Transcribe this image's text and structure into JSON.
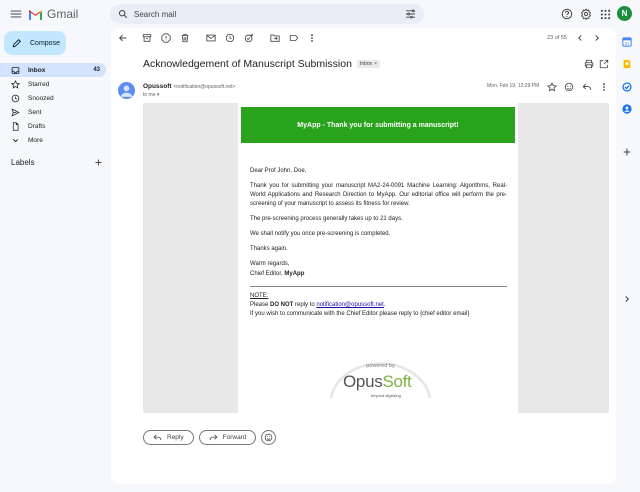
{
  "header": {
    "app_name": "Gmail",
    "search_placeholder": "Search mail",
    "avatar_initial": "N"
  },
  "compose_label": "Compose",
  "sidebar": {
    "items": [
      {
        "label": "Inbox",
        "count": "43",
        "icon": "inbox-icon",
        "active": true
      },
      {
        "label": "Starred",
        "icon": "star-icon"
      },
      {
        "label": "Snoozed",
        "icon": "clock-icon"
      },
      {
        "label": "Sent",
        "icon": "send-icon"
      },
      {
        "label": "Drafts",
        "icon": "draft-icon"
      },
      {
        "label": "More",
        "icon": "chevron-down-icon"
      }
    ],
    "labels_heading": "Labels"
  },
  "toolbar": {
    "pager": "23 of 55"
  },
  "message": {
    "subject": "Acknowledgement of Manuscript Submission",
    "label_chip": "Inbox",
    "sender_name": "Opussoft",
    "sender_address": "<notification@opussoft.net>",
    "to": "to me",
    "date": "Mon, Feb 19, 12:29 PM"
  },
  "email": {
    "banner": "MyApp - Thank you for submitting a manuscript!",
    "greeting": "Dear Prof John, Doe,",
    "para1": "Thank you for submitting your manuscript MA2-24-0091 Machine Learning: Algorithms, Real-World Applications and Research Direction to MyApp. Our editorial office will perform the pre-screening of your manuscript to assess its fitness for review.",
    "para2": "The pre-screening process generally takes up to 21 days.",
    "para3": "We shall notify you once pre-screening is completed.",
    "para4": "Thanks again.",
    "regards": "Warm regards,",
    "signature_prefix": "Chief Editor, ",
    "signature_app": "MyApp",
    "note_heading": "NOTE:",
    "note_please": "Please ",
    "note_donot": "DO NOT",
    "note_reply_to": " reply to ",
    "note_email": "notification@opussoft.net",
    "note_period": ".",
    "note_line2": "If you wish to communicate with the Chief Editor please reply to {chief editor email}",
    "powered_by": "powered by",
    "brand_opus": "Opus",
    "brand_soft": "Soft",
    "brand_tagline": "beyond digitizing"
  },
  "actions": {
    "reply": "Reply",
    "forward": "Forward"
  },
  "colors": {
    "banner_green": "#2aa31c",
    "compose_bg": "#c2e7ff",
    "active_nav": "#d3e3fd",
    "avatar_green": "#1e8e3e"
  }
}
